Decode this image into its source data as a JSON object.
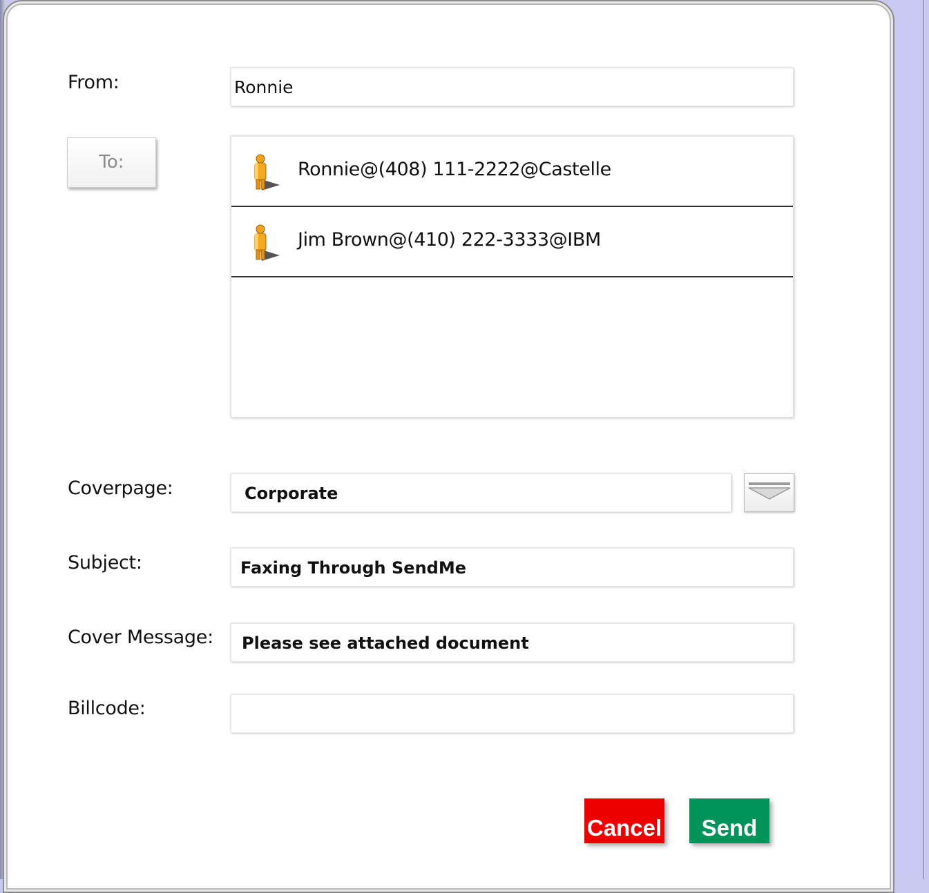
{
  "form": {
    "from_label": "From:",
    "from_value": "Ronnie",
    "to_button_label": "To:",
    "recipients": [
      {
        "text": "Ronnie@(408) 111-2222@Castelle",
        "icon": "person-icon"
      },
      {
        "text": "Jim Brown@(410) 222-3333@IBM",
        "icon": "person-icon"
      }
    ],
    "coverpage_label": "Coverpage:",
    "coverpage_value": "Corporate",
    "subject_label": "Subject:",
    "subject_value": "Faxing Through SendMe",
    "cover_message_label": "Cover Message:",
    "cover_message_value": "Please see attached document",
    "billcode_label": "Billcode:",
    "billcode_value": ""
  },
  "actions": {
    "cancel_label": "Cancel",
    "send_label": "Send"
  },
  "colors": {
    "cancel": "#ee0000",
    "send": "#00935a",
    "background": "#c9c9ef"
  }
}
